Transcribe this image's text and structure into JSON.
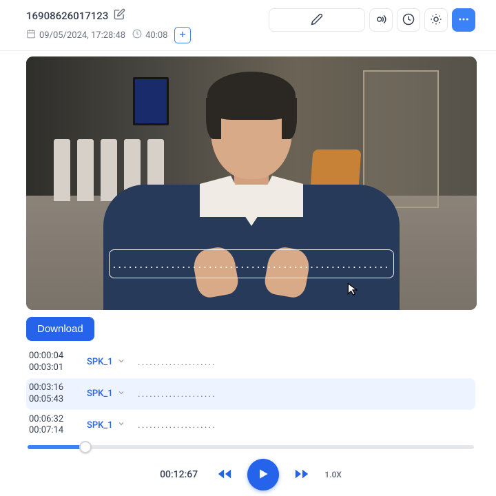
{
  "header": {
    "title": "16908626017123",
    "date": "09/05/2024, 17:28:48",
    "duration": "40:08"
  },
  "caption": {
    "placeholder": "...................................................."
  },
  "actions": {
    "download_label": "Download"
  },
  "transcript": [
    {
      "start": "00:00:04",
      "end": "00:03:01",
      "speaker": "SPK_1",
      "text": "...................."
    },
    {
      "start": "00:03:16",
      "end": "00:05:43",
      "speaker": "SPK_1",
      "text": "...................."
    },
    {
      "start": "00:06:32",
      "end": "00:07:14",
      "speaker": "SPK_1",
      "text": "...................."
    }
  ],
  "player": {
    "current_time": "00:12:67",
    "speed": "1.0X",
    "progress_percent": 13
  }
}
